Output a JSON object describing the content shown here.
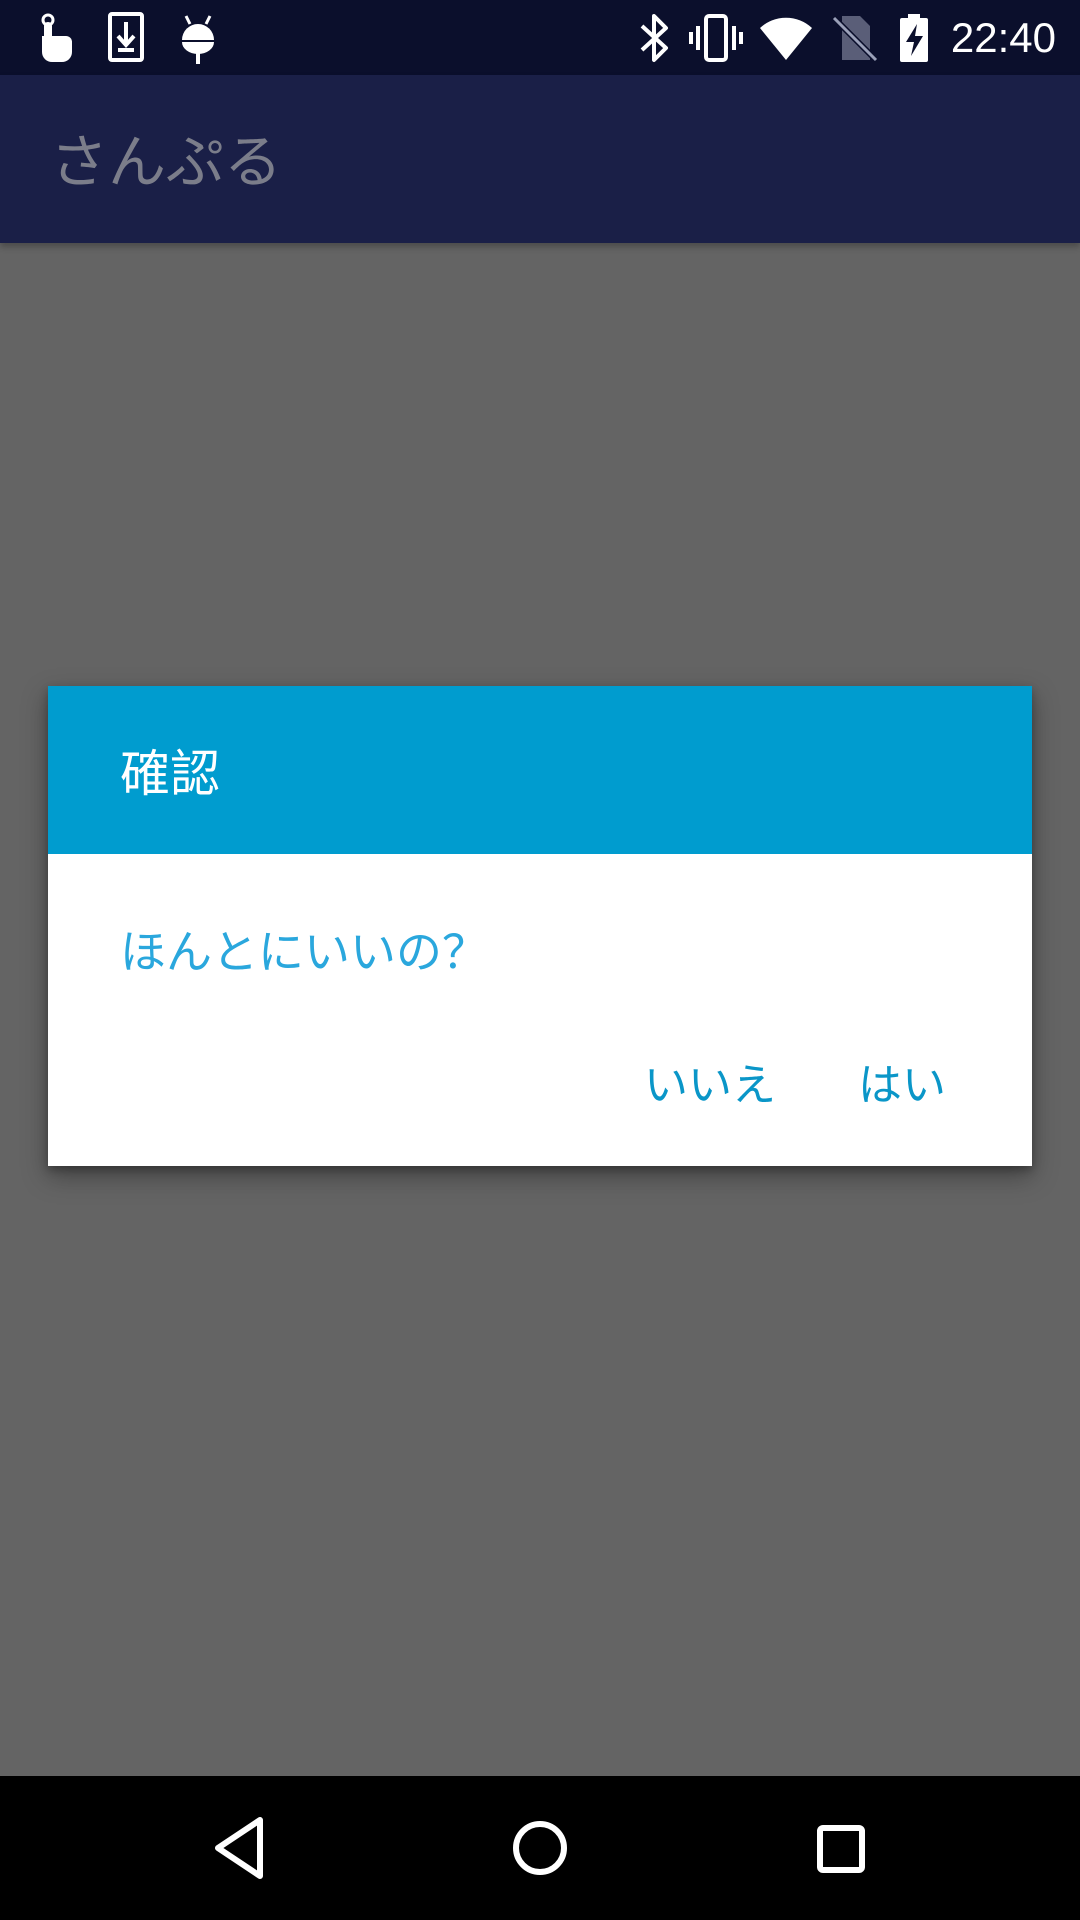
{
  "status_bar": {
    "time": "22:40",
    "left_icons": [
      "touch-gesture-icon",
      "download-icon",
      "android-debug-icon"
    ],
    "right_icons": [
      "bluetooth-icon",
      "vibrate-icon",
      "wifi-icon",
      "no-sim-icon",
      "battery-charging-icon"
    ]
  },
  "app_bar": {
    "title": "さんぷる"
  },
  "dialog": {
    "title": "確認",
    "message": "ほんとにいいの？",
    "negative_label": "いいえ",
    "positive_label": "はい",
    "header_color": "#009ccf",
    "accent_color": "#0a96c8"
  },
  "nav_bar": {
    "icons": [
      "back-icon",
      "home-icon",
      "recents-icon"
    ]
  }
}
